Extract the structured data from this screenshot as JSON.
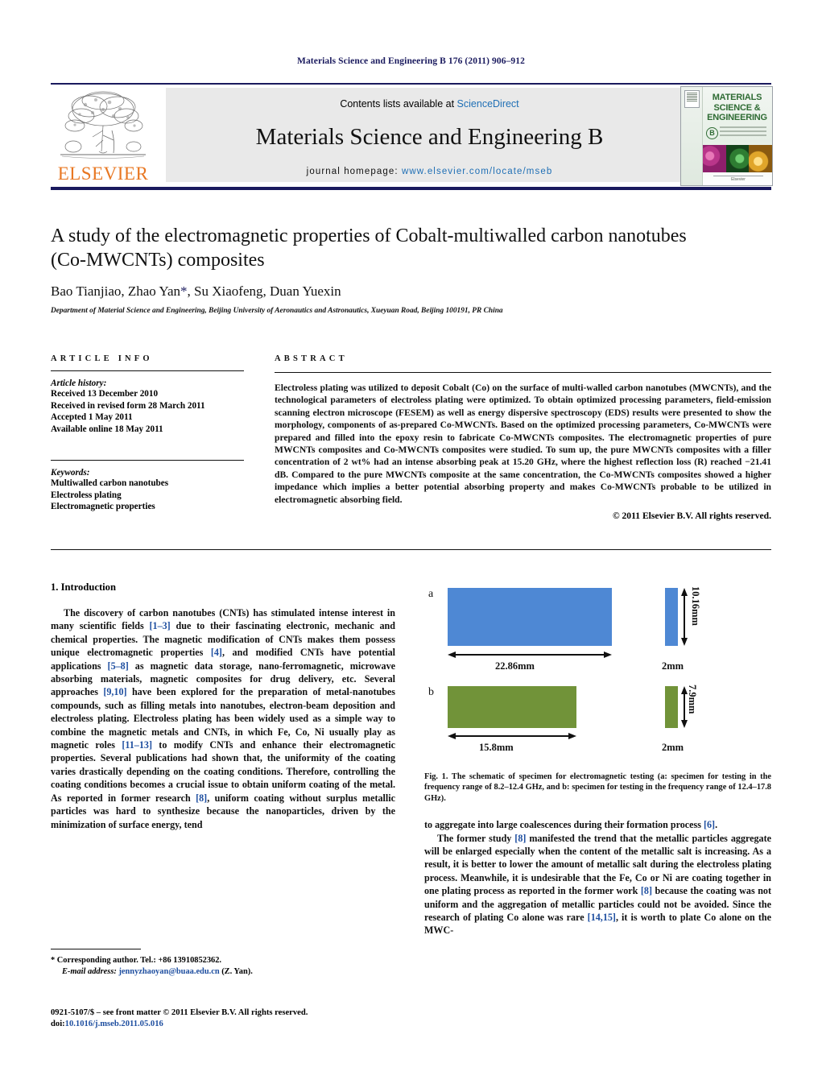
{
  "running_head": "Materials Science and Engineering B 176 (2011) 906–912",
  "masthead": {
    "publisher_name": "ELSEVIER",
    "contents_prefix": "Contents lists available at",
    "contents_link": "ScienceDirect",
    "journal_title": "Materials Science and Engineering B",
    "homepage_label": "journal homepage:",
    "homepage_url": "www.elsevier.com/locate/mseb",
    "cover": {
      "line1": "MATERIALS",
      "line2": "SCIENCE &",
      "line3": "ENGINEERING",
      "badge": "B",
      "footer": "Elsevier"
    }
  },
  "article": {
    "title": "A study of the electromagnetic properties of Cobalt-multiwalled carbon nanotubes (Co-MWCNTs) composites",
    "authors": "Bao Tianjiao, Zhao Yan",
    "authors_suffix": ", Su Xiaofeng, Duan Yuexin",
    "corresponding_marker": "*",
    "affiliation": "Department of Material Science and Engineering, Beijing University of Aeronautics and Astronautics, Xueyuan Road, Beijing 100191, PR China"
  },
  "article_info": {
    "heading": "ARTICLE INFO",
    "history_label": "Article history:",
    "history": [
      "Received 13 December 2010",
      "Received in revised form 28 March 2011",
      "Accepted 1 May 2011",
      "Available online 18 May 2011"
    ],
    "keywords_label": "Keywords:",
    "keywords": [
      "Multiwalled carbon nanotubes",
      "Electroless plating",
      "Electromagnetic properties"
    ]
  },
  "abstract": {
    "heading": "ABSTRACT",
    "text": "Electroless plating was utilized to deposit Cobalt (Co) on the surface of multi-walled carbon nanotubes (MWCNTs), and the technological parameters of electroless plating were optimized. To obtain optimized processing parameters, field-emission scanning electron microscope (FESEM) as well as energy dispersive spectroscopy (EDS) results were presented to show the morphology, components of as-prepared Co-MWCNTs. Based on the optimized processing parameters, Co-MWCNTs were prepared and filled into the epoxy resin to fabricate Co-MWCNTs composites. The electromagnetic properties of pure MWCNTs composites and Co-MWCNTs composites were studied. To sum up, the pure MWCNTs composites with a filler concentration of 2 wt% had an intense absorbing peak at 15.20 GHz, where the highest reflection loss (R) reached −21.41 dB. Compared to the pure MWCNTs composite at the same concentration, the Co-MWCNTs composites showed a higher impedance which implies a better potential absorbing property and makes Co-MWCNTs probable to be utilized in electromagnetic absorbing field.",
    "copyright": "© 2011 Elsevier B.V. All rights reserved."
  },
  "body": {
    "section1_title": "1.  Introduction",
    "left_para1_a": "The discovery of carbon nanotubes (CNTs) has stimulated intense interest in many scientific fields ",
    "left_ref_1_3": "[1–3]",
    "left_para1_b": " due to their fascinating electronic, mechanic and chemical properties. The magnetic modification of CNTs makes them possess unique electromagnetic properties ",
    "left_ref_4": "[4]",
    "left_para1_c": ", and modified CNTs have potential applications ",
    "left_ref_5_8": "[5–8]",
    "left_para1_d": " as magnetic data storage, nano-ferromagnetic, microwave absorbing materials, magnetic composites for drug delivery, etc. Several approaches ",
    "left_ref_9_10": "[9,10]",
    "left_para1_e": " have been explored for the preparation of metal-nanotubes compounds, such as filling metals into nanotubes, electron-beam deposition and electroless plating. Electroless plating has been widely used as a simple way to combine the magnetic metals and CNTs, in which Fe, Co, Ni usually play as magnetic roles ",
    "left_ref_11_13": "[11–13]",
    "left_para1_f": " to modify CNTs and enhance their electromagnetic properties. Several publications had shown that, the uniformity of the coating varies drastically depending on the coating conditions. Therefore, controlling the coating conditions becomes a crucial issue to obtain uniform coating of the metal. As reported in former research ",
    "left_ref_8": "[8]",
    "left_para1_g": ", uniform coating without surplus metallic particles was hard to synthesize because the nanoparticles, driven by the minimization of surface energy, tend",
    "right_para1_a": "to aggregate into large coalescences during their formation process ",
    "right_ref_6": "[6]",
    "right_para1_b": ".",
    "right_para2_a": "The former study ",
    "right_ref_8": "[8]",
    "right_para2_b": " manifested the trend that the metallic particles aggregate will be enlarged especially when the content of the metallic salt is increasing. As a result, it is better to lower the amount of metallic salt during the electroless plating process. Meanwhile, it is undesirable that the Fe, Co or Ni are coating together in one plating process as reported in the former work ",
    "right_ref_8b": "[8]",
    "right_para2_c": " because the coating was not uniform and the aggregation of metallic particles could not be avoided. Since the research of plating Co alone was rare ",
    "right_ref_14_15": "[14,15]",
    "right_para2_d": ", it is worth to plate Co alone on the MWC-"
  },
  "figure": {
    "panel_a_label": "a",
    "panel_b_label": "b",
    "a_width_dim": "22.86mm",
    "a_height_dim": "10.16mm",
    "a_thickness_dim": "2mm",
    "b_width_dim": "15.8mm",
    "b_height_dim": "7.9mm",
    "b_thickness_dim": "2mm",
    "caption_bold": "Fig. 1.",
    "caption": " The schematic of specimen for electromagnetic testing (a: specimen for testing in the frequency range of 8.2–12.4 GHz, and b: specimen for testing in the frequency range of 12.4–17.8 GHz).",
    "colors": {
      "panel_a_fill": "#4e88d4",
      "panel_b_fill": "#719339"
    }
  },
  "footnotes": {
    "corresponding": "* Corresponding author. Tel.: +86 13910852362.",
    "email_label": "E-mail address:",
    "email": "jennyzhaoyan@buaa.edu.cn",
    "email_suffix": " (Z. Yan).",
    "imprint_line1": "0921-5107/$ – see front matter © 2011 Elsevier B.V. All rights reserved.",
    "doi_label": "doi:",
    "doi": "10.1016/j.mseb.2011.05.016"
  }
}
